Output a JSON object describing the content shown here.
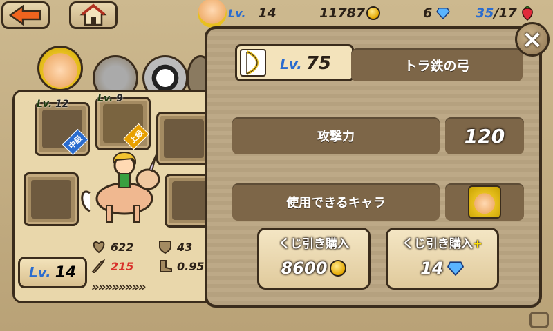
{
  "topbar": {
    "level_label": "Lv.",
    "level_value": "14",
    "coins": "11787",
    "gems": "6",
    "stamina": "35",
    "stamina_max": "/17"
  },
  "left": {
    "slot1_lv": "Lv.",
    "slot1_val": "12",
    "slot1_badge": "中級",
    "slot2_lv": "Lv.",
    "slot2_val": "9",
    "slot2_badge": "上級",
    "player_lv_label": "Lv.",
    "player_lv_value": "14",
    "hp": "622",
    "def": "43",
    "atk": "215",
    "spd": "0.95"
  },
  "dialog": {
    "item_lv_label": "Lv.",
    "item_lv_value": "75",
    "item_name": "トラ鉄の弓",
    "attack_label": "攻撃力",
    "attack_value": "120",
    "usable_label": "使用できるキャラ",
    "buy1_label": "くじ引き購入",
    "buy1_price": "8600",
    "buy2_label": "くじ引き購入",
    "buy2_plus": "+",
    "buy2_price": "14"
  },
  "close_label": "×",
  "colors": {
    "accent_blue": "#2a6ccf",
    "red_stat": "#d9302a",
    "panel_brown": "#7d6648"
  },
  "icons": [
    "back-arrow-icon",
    "home-icon",
    "coin-icon",
    "gem-icon",
    "strawberry-icon",
    "close-icon",
    "bow-icon",
    "heart-icon",
    "shield-icon",
    "sword-icon",
    "boot-icon"
  ]
}
